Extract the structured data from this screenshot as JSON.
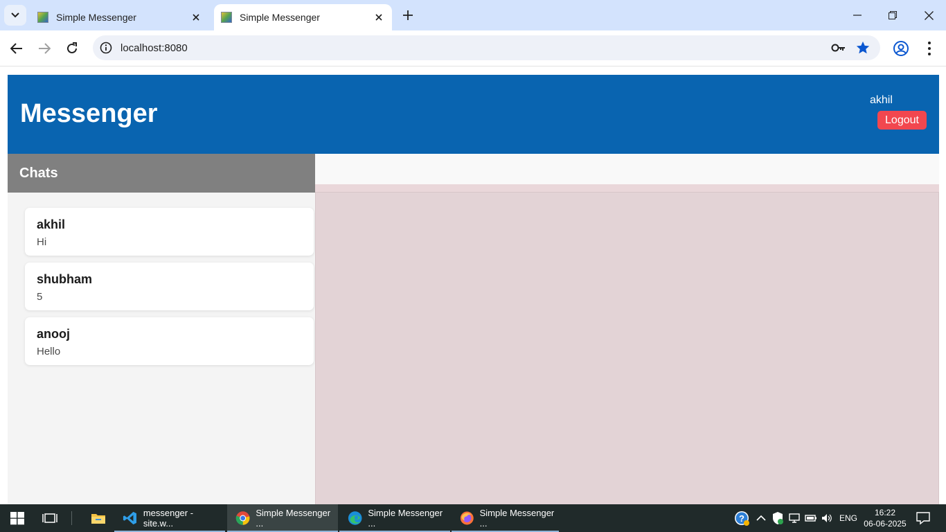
{
  "browser": {
    "tabs": [
      {
        "title": "Simple Messenger",
        "active": false
      },
      {
        "title": "Simple Messenger",
        "active": true
      }
    ],
    "url": "localhost:8080"
  },
  "app": {
    "title": "Messenger",
    "user": "akhil",
    "logout_label": "Logout",
    "colors": {
      "header": "#0964b0",
      "logout": "#f2474f",
      "sidebar_header": "#808080",
      "chat_bg": "#e3d3d6"
    }
  },
  "sidebar": {
    "title": "Chats",
    "chats": [
      {
        "name": "akhil",
        "last_message": "Hi"
      },
      {
        "name": "shubham",
        "last_message": "5"
      },
      {
        "name": "anooj",
        "last_message": "Hello"
      }
    ]
  },
  "taskbar": {
    "apps": [
      {
        "label": "messenger - site.w...",
        "icon": "vscode-icon"
      },
      {
        "label": "Simple Messenger ...",
        "icon": "chrome-icon",
        "active": true
      },
      {
        "label": "Simple Messenger ...",
        "icon": "edge-icon"
      },
      {
        "label": "Simple Messenger ...",
        "icon": "firefox-icon"
      }
    ],
    "language": "ENG",
    "time": "16:22",
    "date": "06-06-2025"
  }
}
